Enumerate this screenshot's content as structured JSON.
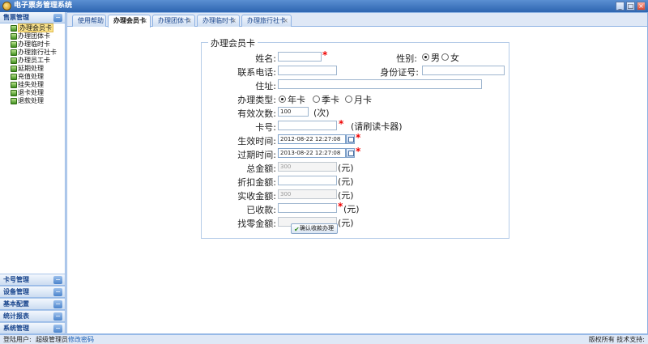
{
  "window": {
    "title": "电子票务管理系统"
  },
  "sidebar": {
    "top_section": "售票管理",
    "items": [
      {
        "label": "办理会员卡",
        "active": true
      },
      {
        "label": "办理团体卡"
      },
      {
        "label": "办理临时卡"
      },
      {
        "label": "办理旅行社卡"
      },
      {
        "label": "办理员工卡"
      },
      {
        "label": "延期处理"
      },
      {
        "label": "充值处理"
      },
      {
        "label": "挂失处理"
      },
      {
        "label": "退卡处理"
      },
      {
        "label": "退款处理"
      }
    ],
    "bottom_sections": [
      "卡号管理",
      "设备管理",
      "基本配置",
      "统计报表",
      "系统管理"
    ]
  },
  "tabs": [
    {
      "label": "使用帮助"
    },
    {
      "label": "办理会员卡",
      "active": true
    },
    {
      "label": "办理团体卡"
    },
    {
      "label": "办理临时卡"
    },
    {
      "label": "办理旅行社卡"
    }
  ],
  "form": {
    "legend": "办理会员卡",
    "name_label": "姓名:",
    "gender_label": "性别:",
    "gender_male": "男",
    "gender_female": "女",
    "phone_label": "联系电话:",
    "idcard_label": "身份证号:",
    "address_label": "住址:",
    "type_label": "办理类型:",
    "type_year": "年卡",
    "type_season": "季卡",
    "type_month": "月卡",
    "count_label": "有效次数:",
    "count_value": "100",
    "count_unit": "(次)",
    "cardno_label": "卡号:",
    "cardno_hint": "(请刷读卡器)",
    "start_label": "生效时间:",
    "start_value": "2012-08-22 12:27:08",
    "end_label": "过期时间:",
    "end_value": "2013-08-22 12:27:08",
    "total_label": "总金额:",
    "total_value": "300",
    "discount_label": "折扣金额:",
    "actual_label": "实收金额:",
    "actual_value": "300",
    "received_label": "已收款:",
    "change_label": "找零金额:",
    "yuan": "(元)",
    "required_mark": "*",
    "confirm_label": "确认收款办理"
  },
  "status": {
    "user_label": "登陆用户:",
    "user_name": "超级管理员",
    "change_pwd": "修改密码",
    "copyright": "版权所有  技术支持:"
  },
  "colors": {
    "accent": "#15428b",
    "required": "#e00000",
    "active_nav": "#fbe48d"
  }
}
